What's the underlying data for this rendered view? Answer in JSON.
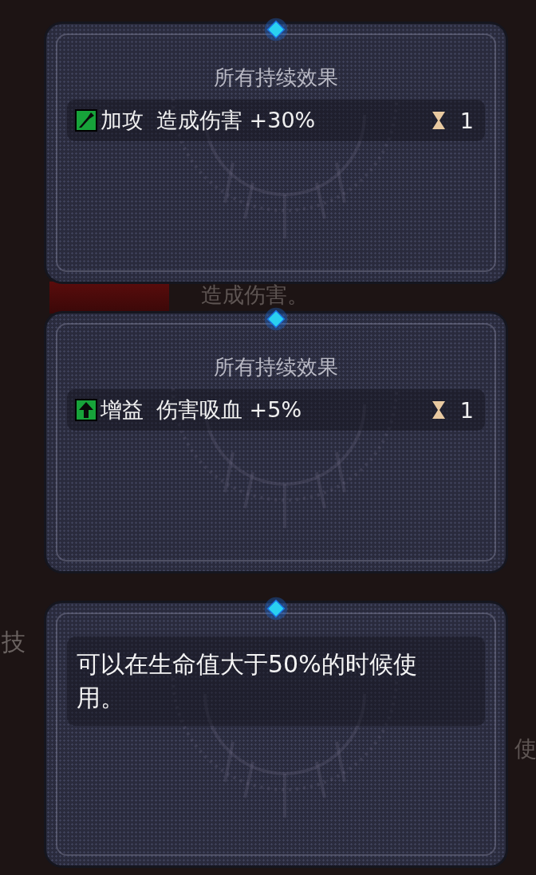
{
  "panels": [
    {
      "kind": "effects",
      "title": "所有持续效果",
      "effects": [
        {
          "kind": "attack",
          "name": "加攻",
          "description": "造成伤害 +30%",
          "turns": "1"
        }
      ]
    },
    {
      "kind": "effects",
      "title": "所有持续效果",
      "effects": [
        {
          "kind": "buff",
          "name": "增益",
          "description": "伤害吸血 +5%",
          "turns": "1"
        }
      ]
    },
    {
      "kind": "text",
      "text": "可以在生命值大于50%的时候使用。"
    }
  ],
  "background": {
    "caption": "造成伤害。",
    "left_label": "技",
    "right_label": "使"
  }
}
